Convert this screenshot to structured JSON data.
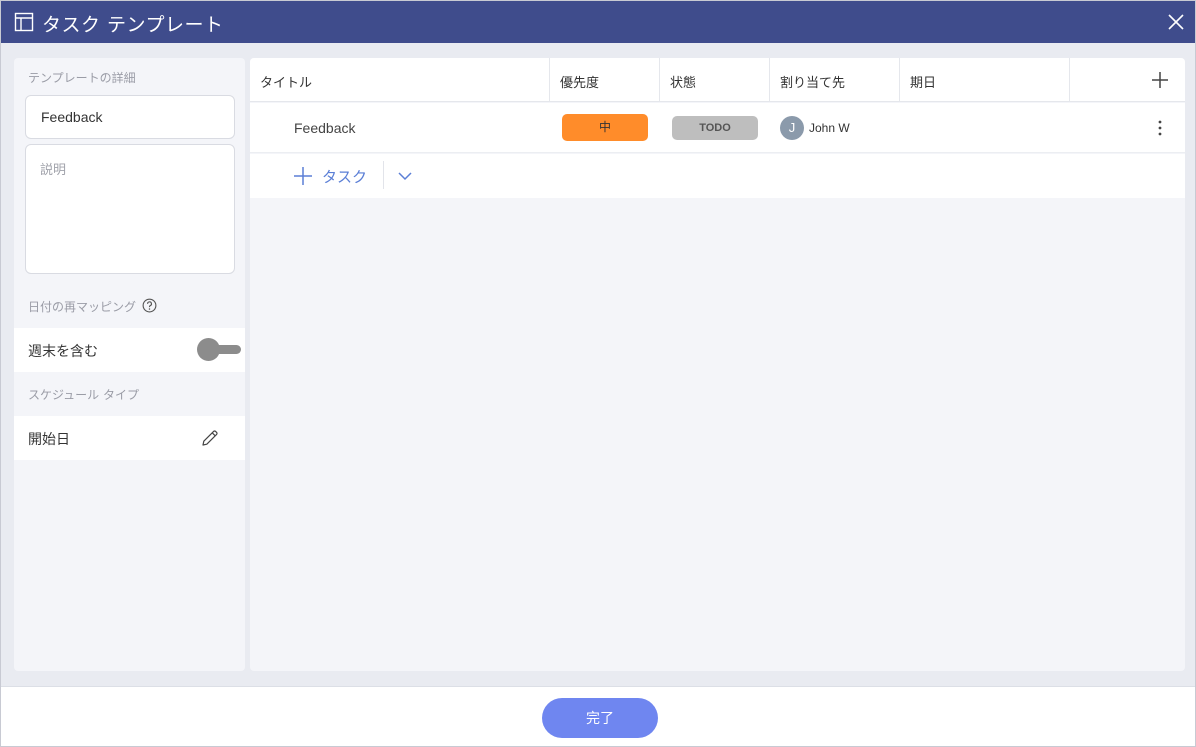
{
  "window": {
    "title": "タスク テンプレート",
    "title_icon": "template-layout-icon",
    "close_icon": "close-icon"
  },
  "left_panel": {
    "details_label": "テンプレートの詳細",
    "name_value": "Feedback",
    "description_placeholder": "説明",
    "date_remap_label": "日付の再マッピング",
    "include_weekends_label": "週末を含む",
    "include_weekends_on": false,
    "schedule_type_label": "スケジュール タイプ",
    "schedule_type_value": "開始日"
  },
  "table": {
    "columns": [
      "タイトル",
      "優先度",
      "状態",
      "割り当て先",
      "期日"
    ],
    "rows": [
      {
        "title": "Feedback",
        "priority": "中",
        "status": "TODO",
        "assignee_initial": "J",
        "assignee": "John W",
        "due": ""
      }
    ],
    "add_task_label": "タスク"
  },
  "footer": {
    "done_label": "完了"
  },
  "colors": {
    "titlebar": "#3f4c8c",
    "priority_medium": "#ff8c2a",
    "status_todo": "#bebebe",
    "accent": "#5b7fd6",
    "done_button": "#6f86f0"
  }
}
